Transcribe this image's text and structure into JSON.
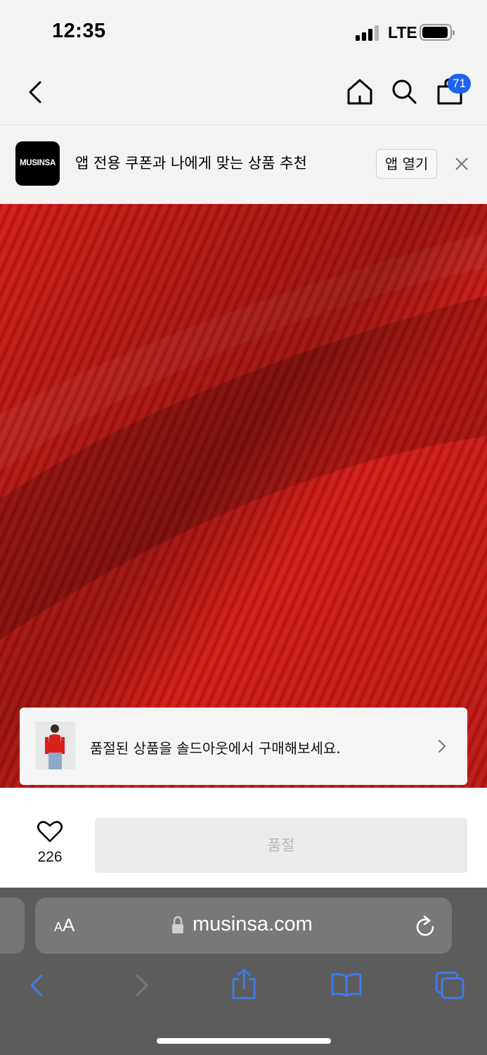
{
  "status_bar": {
    "time": "12:35",
    "network": "LTE"
  },
  "header": {
    "cart_count": "71",
    "icons": [
      "back-icon",
      "home-icon",
      "search-icon",
      "cart-icon"
    ]
  },
  "app_banner": {
    "logo_text": "MUSINSA",
    "text": "앱 전용 쿠폰과 나에게 맞는 상품 추천",
    "open_label": "앱 열기"
  },
  "soldout_card": {
    "text": "품절된 상품을 솔드아웃에서 구매해보세요."
  },
  "action_bar": {
    "like_count": "226",
    "buy_button_label": "품절"
  },
  "browser": {
    "aa_small": "A",
    "aa_big": "A",
    "url": "musinsa.com"
  },
  "colors": {
    "accent_badge": "#1e63f0",
    "product_red": "#c81a17",
    "safari_tint": "#3d7cf0"
  }
}
